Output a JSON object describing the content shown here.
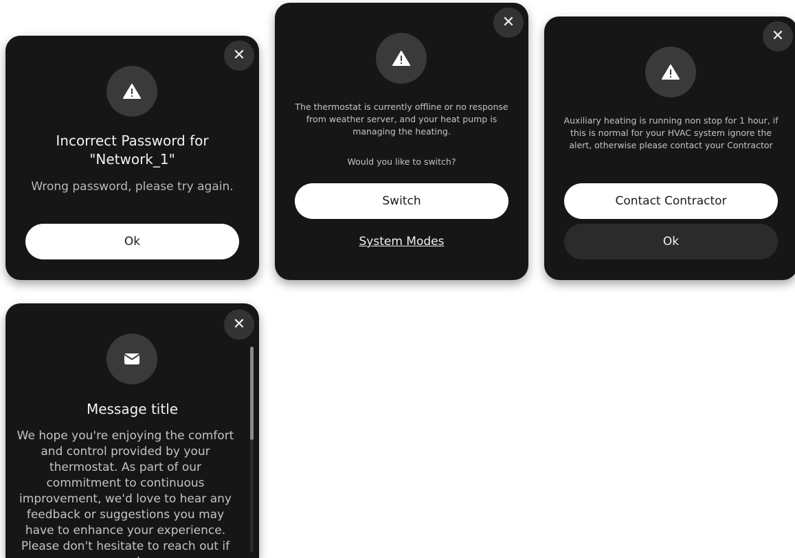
{
  "icons": {
    "close": "close-icon",
    "warning": "warning-icon",
    "envelope": "envelope-icon"
  },
  "colors": {
    "card_bg": "#161616",
    "icon_badge_bg": "#3a3a3a",
    "close_bg": "#333333",
    "primary_button_bg": "#ffffff",
    "secondary_button_bg": "#2b2b2b"
  },
  "cards": {
    "password": {
      "close_glyph": "✕",
      "title": "Incorrect Password for \"Network_1\"",
      "message": "Wrong password, please try again.",
      "ok_label": "Ok"
    },
    "offline": {
      "close_glyph": "✕",
      "message": "The thermostat is currently offline or no response from weather server, and your heat pump is managing the heating.",
      "question": "Would you like to switch?",
      "switch_label": "Switch",
      "system_modes_label": "System Modes"
    },
    "aux_heat": {
      "close_glyph": "✕",
      "message": "Auxiliary heating is  running non stop for 1 hour, if this is normal for your HVAC system ignore the alert, otherwise please contact your Contractor",
      "contact_label": "Contact Contractor",
      "ok_label": "Ok"
    },
    "message": {
      "close_glyph": "✕",
      "title": "Message title",
      "body": "We hope you're enjoying the comfort and control provided by your thermostat. As part of our commitment to continuous improvement, we'd love to hear any feedback or suggestions you may have to enhance your experience. Please don't hesitate to reach out if you need any"
    }
  }
}
